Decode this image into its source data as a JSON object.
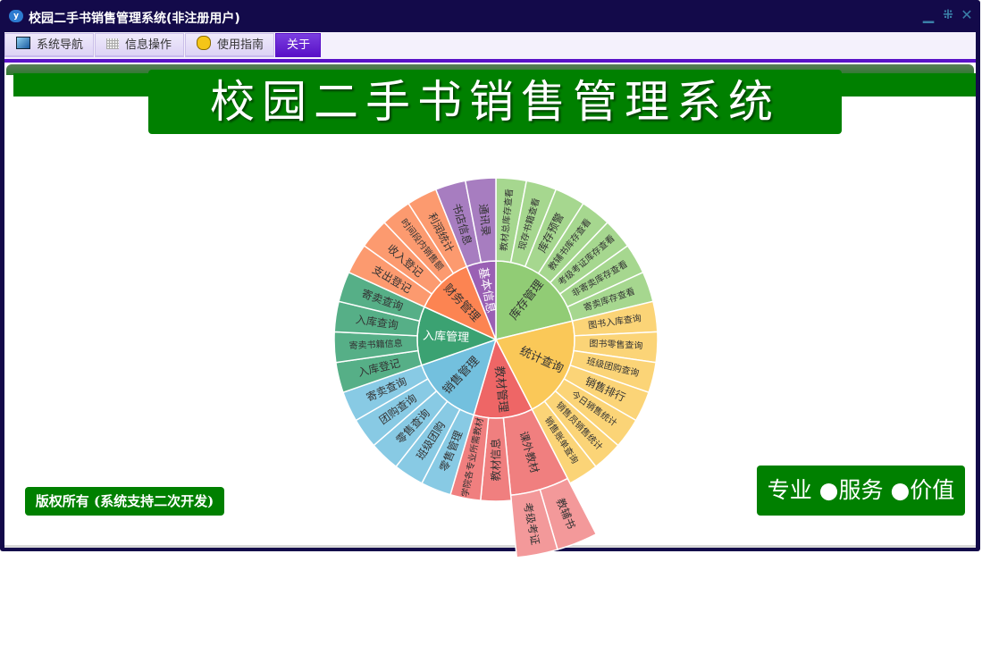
{
  "window": {
    "title": "校园二手书销售管理系统(非注册用户)",
    "controls": [
      "minimize",
      "restore",
      "close"
    ]
  },
  "tabs": [
    {
      "label": "系统导航",
      "icon": "monitor-icon",
      "active": false
    },
    {
      "label": "信息操作",
      "icon": "grid-icon",
      "active": false
    },
    {
      "label": "使用指南",
      "icon": "help-icon",
      "active": false
    },
    {
      "label": "关于",
      "icon": "",
      "active": true
    }
  ],
  "header": {
    "title": "校园二手书销售管理系统"
  },
  "footer": {
    "copyright_button": "版权所有 (系统支持二次开发)",
    "slogan": "专业 ●服务 ●价值"
  },
  "colors": {
    "frame": "#130a4a",
    "accent": "#5a12c8",
    "green": "#008000"
  },
  "chart_data": {
    "type": "sunburst",
    "start": "top, clockwise",
    "series": [
      {
        "name": "库存管理",
        "color": "#91cc75",
        "leaf_color": "#a6d78f",
        "children": [
          {
            "name": "教材总库存查看"
          },
          {
            "name": "现存书籍查看"
          },
          {
            "name": "库存预警"
          },
          {
            "name": "教辅书库存查看"
          },
          {
            "name": "考级考证库存查看"
          },
          {
            "name": "非寄卖库存查看"
          },
          {
            "name": "寄卖库存查看"
          }
        ]
      },
      {
        "name": "统计查询",
        "color": "#fac858",
        "leaf_color": "#fbd477",
        "children": [
          {
            "name": "图书入库查询"
          },
          {
            "name": "图书零售查询"
          },
          {
            "name": "班级团购查询"
          },
          {
            "name": "销售排行"
          },
          {
            "name": "今日销售统计"
          },
          {
            "name": "销售员销售统计"
          },
          {
            "name": "销售账单查询"
          }
        ]
      },
      {
        "name": "教材管理",
        "color": "#ee6666",
        "leaf_color": "#f07f7f",
        "children": [
          {
            "name": "课外教材",
            "children": [
              {
                "name": "教辅书"
              },
              {
                "name": "考级考证"
              }
            ]
          },
          {
            "name": "教材信息"
          },
          {
            "name": "学院各专业所需教材"
          }
        ]
      },
      {
        "name": "销售管理",
        "color": "#73c0de",
        "leaf_color": "#88cae4",
        "children": [
          {
            "name": "零售管理"
          },
          {
            "name": "班级团购"
          },
          {
            "name": "零售查询"
          },
          {
            "name": "团购查询"
          },
          {
            "name": "寄卖查询"
          }
        ]
      },
      {
        "name": "入库管理",
        "color": "#3ba272",
        "leaf_color": "#56af87",
        "children": [
          {
            "name": "入库登记"
          },
          {
            "name": "寄卖书籍信息"
          },
          {
            "name": "入库查询"
          },
          {
            "name": "寄卖查询"
          }
        ]
      },
      {
        "name": "财务管理",
        "color": "#fc8452",
        "leaf_color": "#fc9a6f",
        "children": [
          {
            "name": "支出登记"
          },
          {
            "name": "收入登记"
          },
          {
            "name": "时间段内销售额"
          },
          {
            "name": "利润统计"
          }
        ]
      },
      {
        "name": "基本信息",
        "color": "#9a60b4",
        "leaf_color": "#a77dc0",
        "children": [
          {
            "name": "书店信息"
          },
          {
            "name": "通讯录"
          }
        ]
      }
    ]
  }
}
